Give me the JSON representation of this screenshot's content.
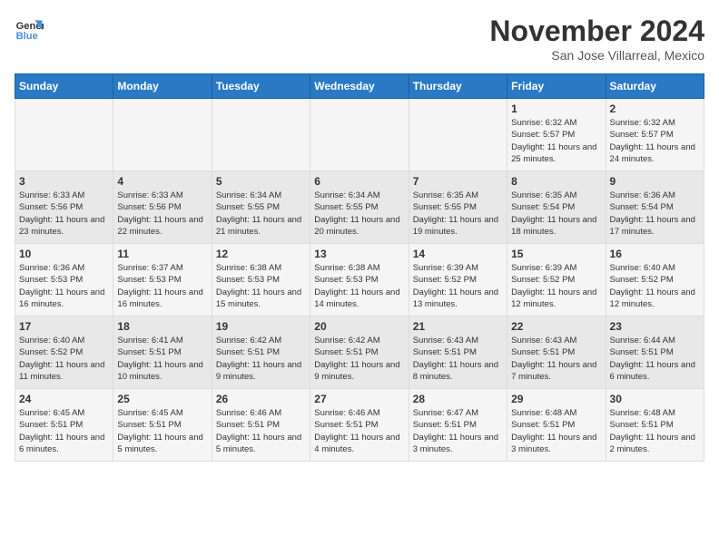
{
  "logo": {
    "line1": "General",
    "line2": "Blue"
  },
  "title": "November 2024",
  "subtitle": "San Jose Villarreal, Mexico",
  "weekdays": [
    "Sunday",
    "Monday",
    "Tuesday",
    "Wednesday",
    "Thursday",
    "Friday",
    "Saturday"
  ],
  "weeks": [
    [
      {
        "day": "",
        "info": ""
      },
      {
        "day": "",
        "info": ""
      },
      {
        "day": "",
        "info": ""
      },
      {
        "day": "",
        "info": ""
      },
      {
        "day": "",
        "info": ""
      },
      {
        "day": "1",
        "info": "Sunrise: 6:32 AM\nSunset: 5:57 PM\nDaylight: 11 hours and 25 minutes."
      },
      {
        "day": "2",
        "info": "Sunrise: 6:32 AM\nSunset: 5:57 PM\nDaylight: 11 hours and 24 minutes."
      }
    ],
    [
      {
        "day": "3",
        "info": "Sunrise: 6:33 AM\nSunset: 5:56 PM\nDaylight: 11 hours and 23 minutes."
      },
      {
        "day": "4",
        "info": "Sunrise: 6:33 AM\nSunset: 5:56 PM\nDaylight: 11 hours and 22 minutes."
      },
      {
        "day": "5",
        "info": "Sunrise: 6:34 AM\nSunset: 5:55 PM\nDaylight: 11 hours and 21 minutes."
      },
      {
        "day": "6",
        "info": "Sunrise: 6:34 AM\nSunset: 5:55 PM\nDaylight: 11 hours and 20 minutes."
      },
      {
        "day": "7",
        "info": "Sunrise: 6:35 AM\nSunset: 5:55 PM\nDaylight: 11 hours and 19 minutes."
      },
      {
        "day": "8",
        "info": "Sunrise: 6:35 AM\nSunset: 5:54 PM\nDaylight: 11 hours and 18 minutes."
      },
      {
        "day": "9",
        "info": "Sunrise: 6:36 AM\nSunset: 5:54 PM\nDaylight: 11 hours and 17 minutes."
      }
    ],
    [
      {
        "day": "10",
        "info": "Sunrise: 6:36 AM\nSunset: 5:53 PM\nDaylight: 11 hours and 16 minutes."
      },
      {
        "day": "11",
        "info": "Sunrise: 6:37 AM\nSunset: 5:53 PM\nDaylight: 11 hours and 16 minutes."
      },
      {
        "day": "12",
        "info": "Sunrise: 6:38 AM\nSunset: 5:53 PM\nDaylight: 11 hours and 15 minutes."
      },
      {
        "day": "13",
        "info": "Sunrise: 6:38 AM\nSunset: 5:53 PM\nDaylight: 11 hours and 14 minutes."
      },
      {
        "day": "14",
        "info": "Sunrise: 6:39 AM\nSunset: 5:52 PM\nDaylight: 11 hours and 13 minutes."
      },
      {
        "day": "15",
        "info": "Sunrise: 6:39 AM\nSunset: 5:52 PM\nDaylight: 11 hours and 12 minutes."
      },
      {
        "day": "16",
        "info": "Sunrise: 6:40 AM\nSunset: 5:52 PM\nDaylight: 11 hours and 12 minutes."
      }
    ],
    [
      {
        "day": "17",
        "info": "Sunrise: 6:40 AM\nSunset: 5:52 PM\nDaylight: 11 hours and 11 minutes."
      },
      {
        "day": "18",
        "info": "Sunrise: 6:41 AM\nSunset: 5:51 PM\nDaylight: 11 hours and 10 minutes."
      },
      {
        "day": "19",
        "info": "Sunrise: 6:42 AM\nSunset: 5:51 PM\nDaylight: 11 hours and 9 minutes."
      },
      {
        "day": "20",
        "info": "Sunrise: 6:42 AM\nSunset: 5:51 PM\nDaylight: 11 hours and 9 minutes."
      },
      {
        "day": "21",
        "info": "Sunrise: 6:43 AM\nSunset: 5:51 PM\nDaylight: 11 hours and 8 minutes."
      },
      {
        "day": "22",
        "info": "Sunrise: 6:43 AM\nSunset: 5:51 PM\nDaylight: 11 hours and 7 minutes."
      },
      {
        "day": "23",
        "info": "Sunrise: 6:44 AM\nSunset: 5:51 PM\nDaylight: 11 hours and 6 minutes."
      }
    ],
    [
      {
        "day": "24",
        "info": "Sunrise: 6:45 AM\nSunset: 5:51 PM\nDaylight: 11 hours and 6 minutes."
      },
      {
        "day": "25",
        "info": "Sunrise: 6:45 AM\nSunset: 5:51 PM\nDaylight: 11 hours and 5 minutes."
      },
      {
        "day": "26",
        "info": "Sunrise: 6:46 AM\nSunset: 5:51 PM\nDaylight: 11 hours and 5 minutes."
      },
      {
        "day": "27",
        "info": "Sunrise: 6:46 AM\nSunset: 5:51 PM\nDaylight: 11 hours and 4 minutes."
      },
      {
        "day": "28",
        "info": "Sunrise: 6:47 AM\nSunset: 5:51 PM\nDaylight: 11 hours and 3 minutes."
      },
      {
        "day": "29",
        "info": "Sunrise: 6:48 AM\nSunset: 5:51 PM\nDaylight: 11 hours and 3 minutes."
      },
      {
        "day": "30",
        "info": "Sunrise: 6:48 AM\nSunset: 5:51 PM\nDaylight: 11 hours and 2 minutes."
      }
    ]
  ]
}
